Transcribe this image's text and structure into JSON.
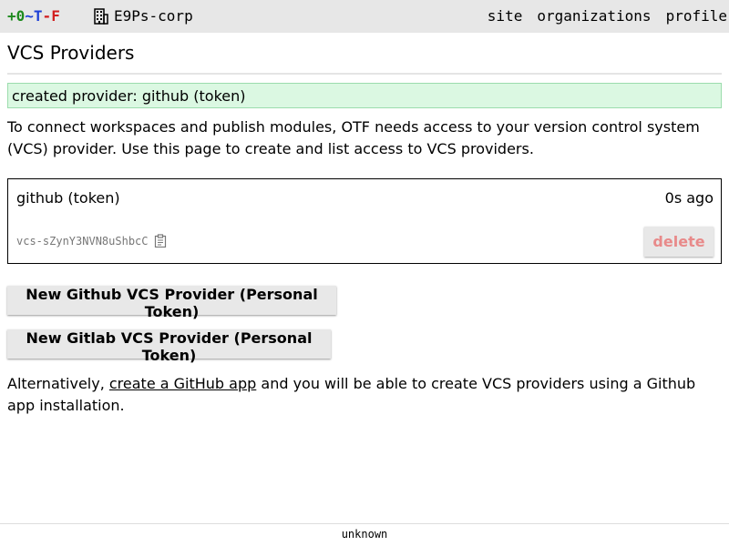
{
  "topbar": {
    "logo": {
      "plus": "+0",
      "tilde": "~",
      "t": "T",
      "minus": "-",
      "f": "F"
    },
    "org_icon": "building-icon",
    "org_name": "E9Ps-corp",
    "nav": [
      "site",
      "organizations",
      "profile"
    ]
  },
  "page": {
    "title": "VCS Providers",
    "flash": "created provider: github (token)",
    "intro": "To connect workspaces and publish modules, OTF needs access to your version control system (VCS) provider. Use this page to create and list access to VCS providers."
  },
  "providers": [
    {
      "name": "github (token)",
      "time": "0s ago",
      "id": "vcs-sZynY3NVN8uShbcC",
      "copy_icon": "clipboard-icon",
      "delete_label": "delete"
    }
  ],
  "actions": {
    "new_github": "New Github VCS Provider (Personal Token)",
    "new_gitlab": "New Gitlab VCS Provider (Personal Token)"
  },
  "alternative": {
    "before": "Alternatively, ",
    "link": "create a GitHub app",
    "after": " and you will be able to create VCS providers using a Github app installation."
  },
  "footer": {
    "text": "unknown"
  },
  "colors": {
    "topbar_bg": "#e7e7e7",
    "flash_bg": "#dbf8e2",
    "flash_border": "#9bdcad",
    "delete_text": "#e88a8a",
    "logo_green": "#1e8a1e",
    "logo_blue": "#1d3fd6",
    "logo_red": "#d21f1f"
  }
}
